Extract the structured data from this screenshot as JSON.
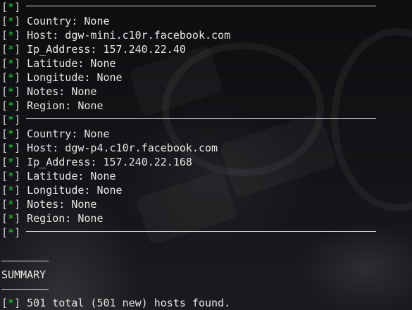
{
  "prefix": {
    "open": "[",
    "star": "*",
    "close": "]"
  },
  "records": [
    {
      "country": "Country: None",
      "host": "Host: dgw-mini.c10r.facebook.com",
      "ip": "Ip_Address: 157.240.22.40",
      "latitude": "Latitude: None",
      "longitude": "Longitude: None",
      "notes": "Notes: None",
      "region": "Region: None"
    },
    {
      "country": "Country: None",
      "host": "Host: dgw-p4.c10r.facebook.com",
      "ip": "Ip_Address: 157.240.22.168",
      "latitude": "Latitude: None",
      "longitude": "Longitude: None",
      "notes": "Notes: None",
      "region": "Region: None"
    }
  ],
  "summary": {
    "heading": "SUMMARY",
    "result": "501 total (501 new) hosts found."
  },
  "colors": {
    "star": "#2ecc40",
    "text": "#e6e6e6",
    "background": "#111214"
  }
}
